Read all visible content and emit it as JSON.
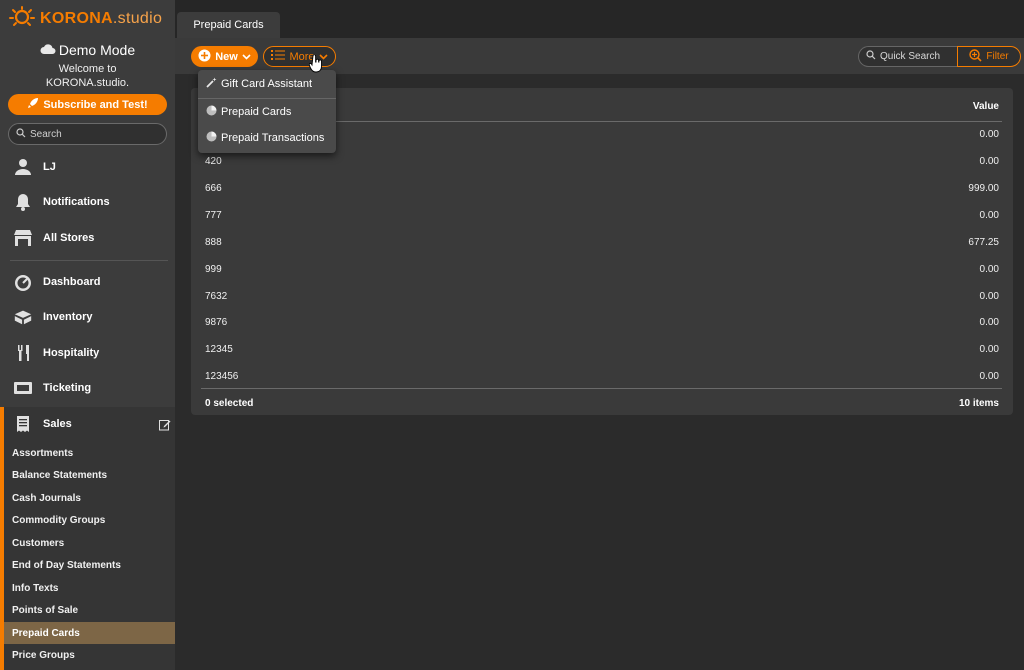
{
  "brand": {
    "name_bold": "KORONA",
    "name_thin": ".studio"
  },
  "demo": {
    "title": "Demo Mode",
    "welcome_line1": "Welcome to",
    "welcome_line2": "KORONA.studio."
  },
  "subscribe_label": "Subscribe and Test!",
  "sidebar_search_placeholder": "Search",
  "nav_top": [
    {
      "label": "LJ",
      "icon": "user-icon"
    },
    {
      "label": "Notifications",
      "icon": "bell-icon"
    },
    {
      "label": "All Stores",
      "icon": "store-icon"
    }
  ],
  "nav_main": [
    {
      "label": "Dashboard",
      "icon": "gauge-icon"
    },
    {
      "label": "Inventory",
      "icon": "inventory-icon"
    },
    {
      "label": "Hospitality",
      "icon": "utensils-icon"
    },
    {
      "label": "Ticketing",
      "icon": "ticket-icon"
    }
  ],
  "sales": {
    "label": "Sales",
    "items": [
      "Assortments",
      "Balance Statements",
      "Cash Journals",
      "Commodity Groups",
      "Customers",
      "End of Day Statements",
      "Info Texts",
      "Points of Sale",
      "Prepaid Cards",
      "Price Groups"
    ],
    "active_item": "Prepaid Cards"
  },
  "tab_label": "Prepaid Cards",
  "toolbar": {
    "new_label": "New",
    "more_label": "More",
    "quick_search_placeholder": "Quick Search",
    "filter_label": "Filter"
  },
  "dropdown": {
    "items": [
      {
        "label": "Gift Card Assistant",
        "icon": "magic-wand-icon"
      },
      {
        "label": "Prepaid Cards",
        "icon": "pie-chart-icon"
      },
      {
        "label": "Prepaid Transactions",
        "icon": "pie-chart-icon"
      }
    ]
  },
  "table": {
    "value_header": "Value",
    "rows": [
      {
        "number": "",
        "value": "0.00"
      },
      {
        "number": "420",
        "value": "0.00"
      },
      {
        "number": "666",
        "value": "999.00"
      },
      {
        "number": "777",
        "value": "0.00"
      },
      {
        "number": "888",
        "value": "677.25"
      },
      {
        "number": "999",
        "value": "0.00"
      },
      {
        "number": "7632",
        "value": "0.00"
      },
      {
        "number": "9876",
        "value": "0.00"
      },
      {
        "number": "12345",
        "value": "0.00"
      },
      {
        "number": "123456",
        "value": "0.00"
      }
    ],
    "selected_text": "0 selected",
    "items_text": "10 items"
  },
  "colors": {
    "accent": "#f57c00",
    "active_nav": "#7d6646",
    "sidebar_bg": "#3c3c3c",
    "page_bg": "#2b2b2b"
  }
}
